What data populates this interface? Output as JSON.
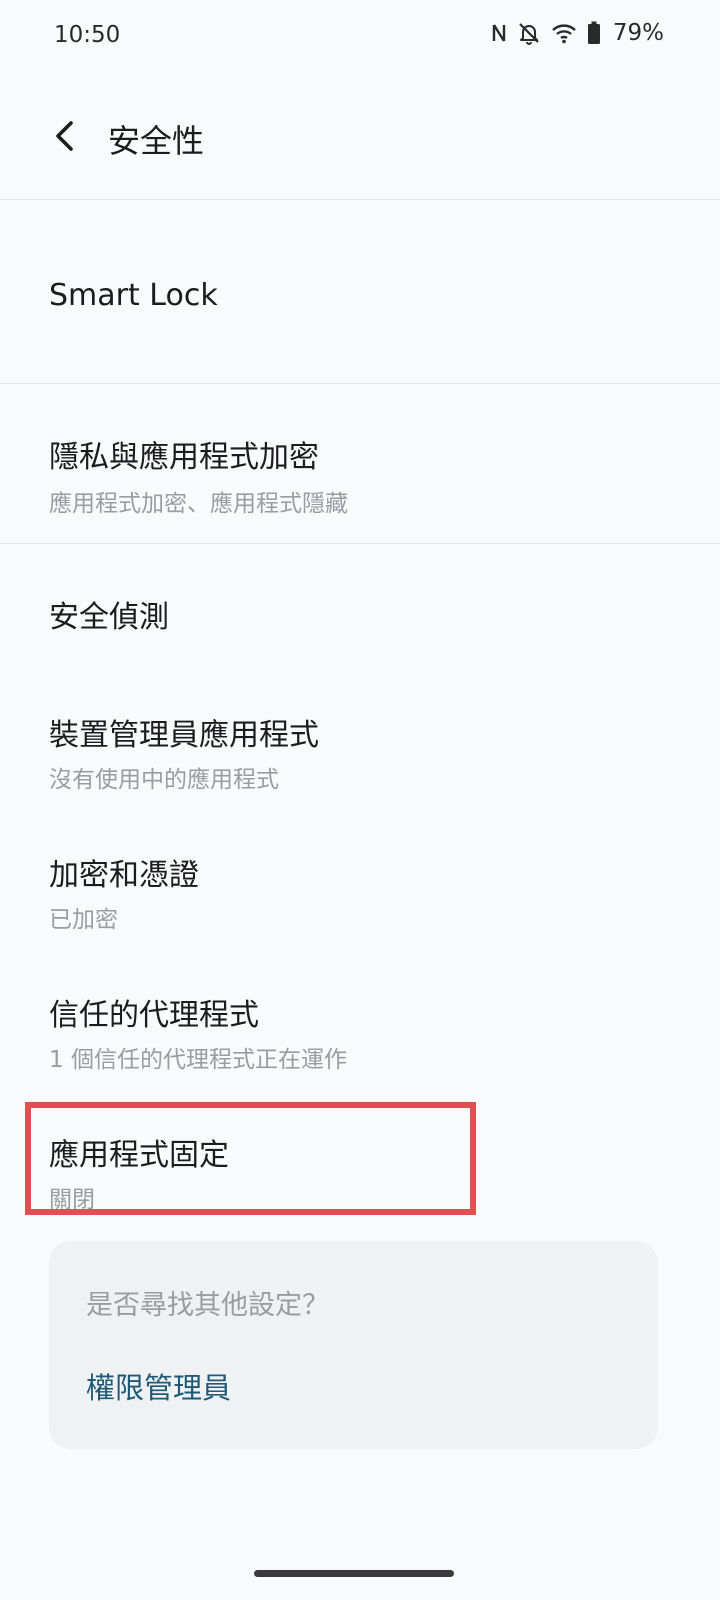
{
  "status_bar": {
    "time": "10:50",
    "battery_percent": "79%",
    "icons": [
      "nfc-icon",
      "bell-off-icon",
      "wifi-icon",
      "battery-icon"
    ]
  },
  "header": {
    "title": "安全性",
    "back_icon": "back-arrow-icon"
  },
  "settings": {
    "items": [
      {
        "title": "Smart Lock",
        "subtitle": ""
      },
      {
        "title": "隱私與應用程式加密",
        "subtitle": "應用程式加密、應用程式隱藏"
      },
      {
        "title": "安全偵測",
        "subtitle": ""
      },
      {
        "title": "裝置管理員應用程式",
        "subtitle": "沒有使用中的應用程式"
      },
      {
        "title": "加密和憑證",
        "subtitle": "已加密"
      },
      {
        "title": "信任的代理程式",
        "subtitle": "1 個信任的代理程式正在運作"
      },
      {
        "title": "應用程式固定",
        "subtitle": "關閉"
      }
    ]
  },
  "suggestion": {
    "question": "是否尋找其他設定？",
    "link_label": "權限管理員"
  },
  "colors": {
    "background": "#f9fafc",
    "highlight": "#e05050",
    "link": "#1e5a78",
    "card": "#f0f1f3"
  }
}
